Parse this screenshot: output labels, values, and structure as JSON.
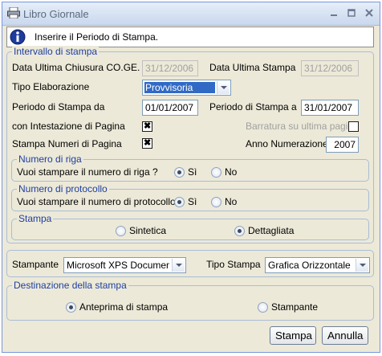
{
  "window": {
    "title": "Libro Giornale"
  },
  "info": {
    "message": "Inserire il Periodo di Stampa."
  },
  "intervallo": {
    "title": "Intervallo di stampa",
    "data_chiusura_label": "Data Ultima Chiusura CO.GE.",
    "data_chiusura_value": "31/12/2006",
    "data_stampa_label": "Data Ultima Stampa",
    "data_stampa_value": "31/12/2006",
    "tipo_label": "Tipo Elaborazione",
    "tipo_value": "Provvisoria",
    "periodo_da_label": "Periodo di Stampa da",
    "periodo_da_value": "01/01/2007",
    "periodo_a_label": "Periodo di Stampa a",
    "periodo_a_value": "31/01/2007",
    "intestazione_label": "con Intestazione di Pagina",
    "barratura_label": "Barratura su ultima pagina",
    "numeri_pagina_label": "Stampa Numeri di Pagina",
    "anno_label": "Anno Numerazione",
    "anno_value": "2007"
  },
  "numero_riga": {
    "title": "Numero di riga",
    "question": "Vuoi stampare il numero di riga ?",
    "yes": "Sì",
    "no": "No"
  },
  "numero_protocollo": {
    "title": "Numero di protocollo",
    "question": "Vuoi stampare il numero di protocollo ?",
    "yes": "Sì",
    "no": "No"
  },
  "stampa": {
    "title": "Stampa",
    "sintetica": "Sintetica",
    "dettagliata": "Dettagliata"
  },
  "printer": {
    "stampante_label": "Stampante",
    "stampante_value": "Microsoft XPS Document Writer",
    "tipo_stampa_label": "Tipo Stampa",
    "tipo_stampa_value": "Grafica Orizzontale"
  },
  "destinazione": {
    "title": "Destinazione della stampa",
    "anteprima": "Anteprima di stampa",
    "stampante": "Stampante"
  },
  "buttons": {
    "stampa": "Stampa",
    "annulla": "Annulla"
  },
  "colors": {
    "group_title": "#1F3FA0",
    "selection": "#316AC5",
    "disabled_text": "#A0A0A0"
  }
}
